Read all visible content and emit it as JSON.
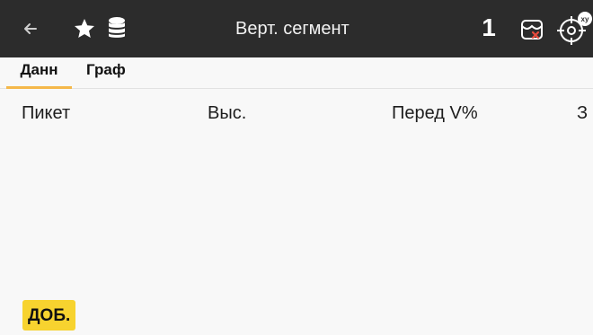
{
  "header": {
    "title": "Верт. сегмент",
    "badge_number": "1",
    "back_icon": "back-arrow-icon",
    "favorite_icon": "star-icon",
    "database_icon": "database-icon",
    "subscription_icon": "storefront-icon",
    "gps_icon": "crosshair-xy-icon"
  },
  "tabs": [
    {
      "label": "Данн",
      "active": true
    },
    {
      "label": "Граф",
      "active": false
    }
  ],
  "table": {
    "columns": [
      "Пикет",
      "Выс.",
      "Перед V%",
      "З"
    ],
    "rows": []
  },
  "actions": {
    "add_label": "ДОБ."
  },
  "colors": {
    "header_bg": "#2c2c2c",
    "tab_indicator": "#f5b84a",
    "add_button": "#f7d32f",
    "page_bg": "#f8f8f8",
    "accent_red": "#e84b3c"
  }
}
